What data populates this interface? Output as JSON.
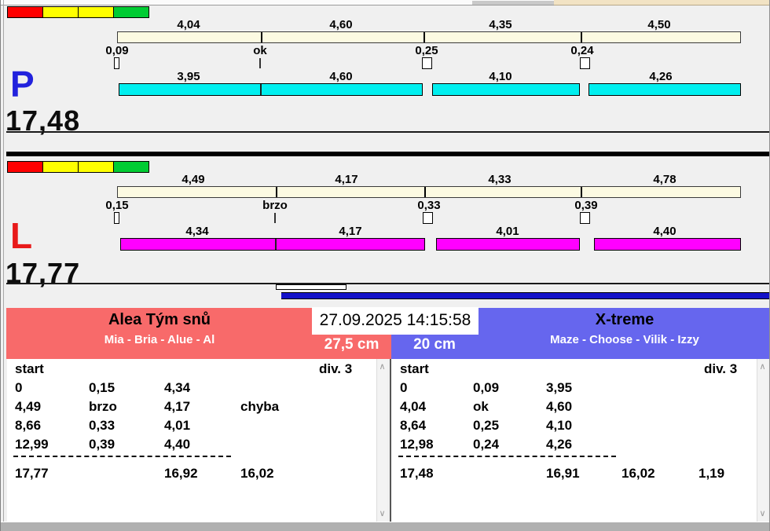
{
  "datetime": "27.09.2025 14:15:58",
  "icons": {
    "scroll_up": "∧",
    "scroll_down": "∨"
  },
  "colors": {
    "header_left": "#f86a6a",
    "header_right": "#6666ee",
    "lane_p_bar": "#00efef",
    "lane_l_bar": "#ff00ff",
    "timeline_bar": "#fcfae2",
    "progress_bar": "#1312c8",
    "strip": [
      "#ff0000",
      "#ffff00",
      "#ffff00",
      "#00cc33"
    ]
  },
  "lanes": [
    {
      "label": "P",
      "total": "17,48",
      "letter_color": "#2222dd",
      "top_values": [
        "4,04",
        "4,60",
        "4,35",
        "4,50"
      ],
      "exchanges": [
        "0,09",
        "ok",
        "0,25",
        "0,24"
      ],
      "bottom_values": [
        "3,95",
        "4,60",
        "4,10",
        "4,26"
      ]
    },
    {
      "label": "L",
      "total": "17,77",
      "letter_color": "#e81a1a",
      "top_values": [
        "4,49",
        "4,17",
        "4,33",
        "4,78"
      ],
      "exchanges": [
        "0,15",
        "brzo",
        "0,33",
        "0,39"
      ],
      "bottom_values": [
        "4,34",
        "4,17",
        "4,01",
        "4,40"
      ]
    }
  ],
  "teams": [
    {
      "name": "Alea Tým snů",
      "members": "Mia - Bria - Alue - Al",
      "category": "27,5 cm",
      "table": {
        "start_label": "start",
        "div_label": "div. 3",
        "rows": [
          [
            "0",
            "0,15",
            "4,34",
            ""
          ],
          [
            "4,49",
            "brzo",
            "4,17",
            "chyba"
          ],
          [
            "8,66",
            "0,33",
            "4,01",
            ""
          ],
          [
            "12,99",
            "0,39",
            "4,40",
            ""
          ]
        ],
        "totals": [
          "17,77",
          "16,92",
          "16,02"
        ]
      }
    },
    {
      "name": "X-treme",
      "members": "Maze - Choose - Vilik - Izzy",
      "category": "20 cm",
      "table": {
        "start_label": "start",
        "div_label": "div. 3",
        "rows": [
          [
            "0",
            "0,09",
            "3,95",
            ""
          ],
          [
            "4,04",
            "ok",
            "4,60",
            ""
          ],
          [
            "8,64",
            "0,25",
            "4,10",
            ""
          ],
          [
            "12,98",
            "0,24",
            "4,26",
            ""
          ]
        ],
        "totals": [
          "17,48",
          "16,91",
          "16,02",
          "1,19"
        ]
      }
    }
  ]
}
